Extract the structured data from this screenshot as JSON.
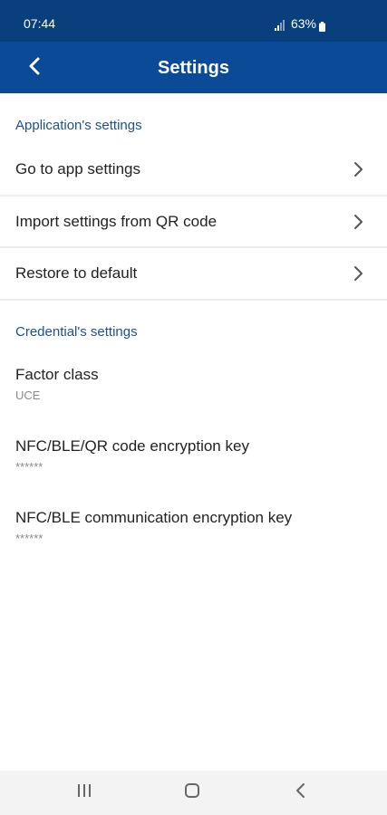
{
  "status_bar": {
    "time": "07:44",
    "battery": "63%"
  },
  "app_bar": {
    "title": "Settings",
    "back_icon": "chevron-left-icon"
  },
  "sections": {
    "application": {
      "header": "Application's settings",
      "items": [
        {
          "label": "Go to app settings",
          "icon": "chevron-right-icon"
        },
        {
          "label": "Import settings from QR code",
          "icon": "chevron-right-icon"
        },
        {
          "label": "Restore to default",
          "icon": "chevron-right-icon"
        }
      ]
    },
    "credential": {
      "header": "Credential's settings",
      "items": [
        {
          "title": "Factor class",
          "value": "UCE"
        },
        {
          "title": "NFC/BLE/QR code encryption key",
          "value": "******"
        },
        {
          "title": "NFC/BLE communication encryption key",
          "value": "******"
        }
      ]
    }
  },
  "system_nav": {
    "recents_icon": "recents-icon",
    "home_icon": "home-icon",
    "back_icon": "back-icon"
  },
  "colors": {
    "status_bar": "#0a3f7e",
    "app_bar": "#0b4a96",
    "section_header": "#1d4f91",
    "secondary_text": "#8a8a8a"
  }
}
